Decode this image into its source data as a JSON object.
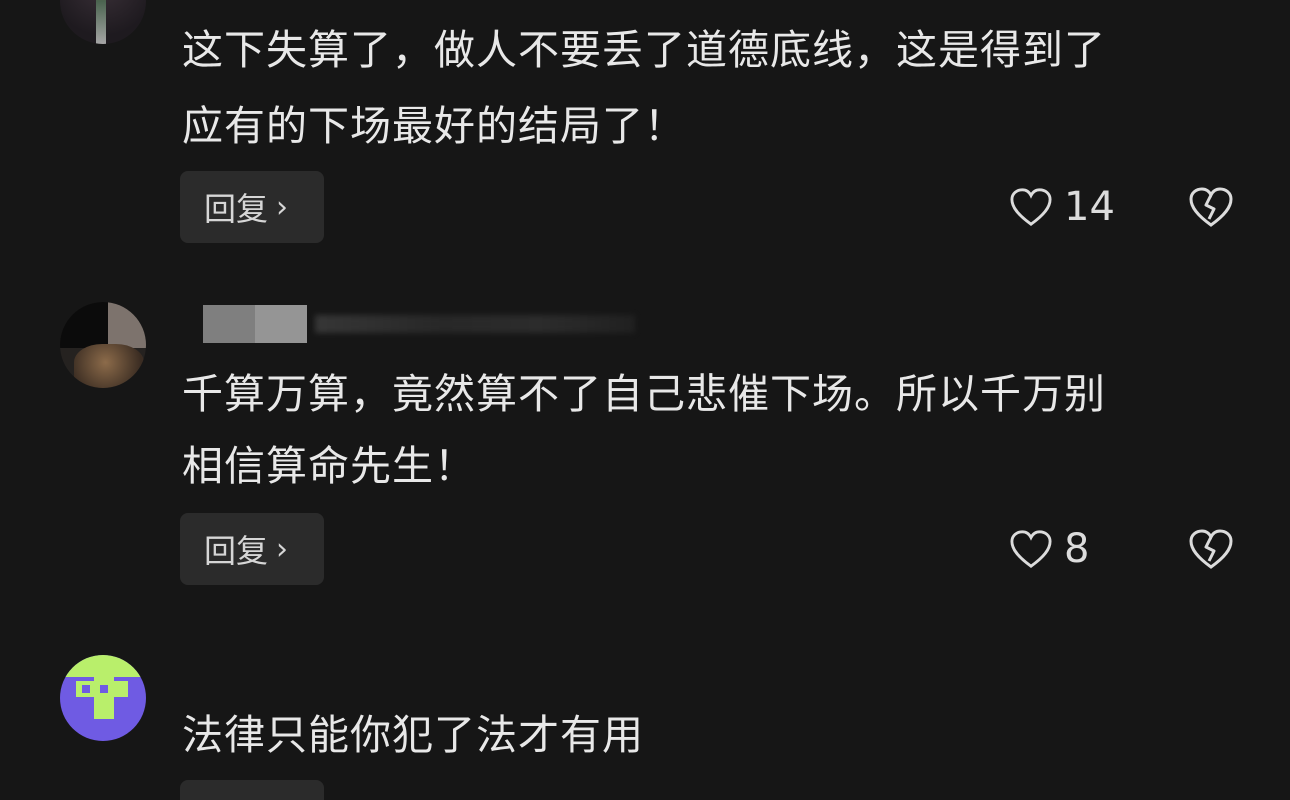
{
  "comments": [
    {
      "text_lines": [
        "这下失算了，做人不要丢了道德底线，这是得到了",
        "应有的下场最好的结局了！"
      ],
      "reply_label": "回复",
      "likes": "14"
    },
    {
      "text_lines": [
        "千算万算，竟然算不了自己悲催下场。所以千万别",
        "相信算命先生！"
      ],
      "reply_label": "回复",
      "likes": "8"
    },
    {
      "text_lines": [
        "法律只能你犯了法才有用"
      ]
    }
  ],
  "icons": {
    "reply_chevron": "chevron-right-icon",
    "like": "heart-outline-icon",
    "dislike": "broken-heart-icon"
  },
  "colors": {
    "background": "#161616",
    "text": "#e8e8e8",
    "button_bg": "#2b2b2b",
    "avatar3_purple": "#6f5be3",
    "avatar3_green": "#b9ef6b"
  }
}
